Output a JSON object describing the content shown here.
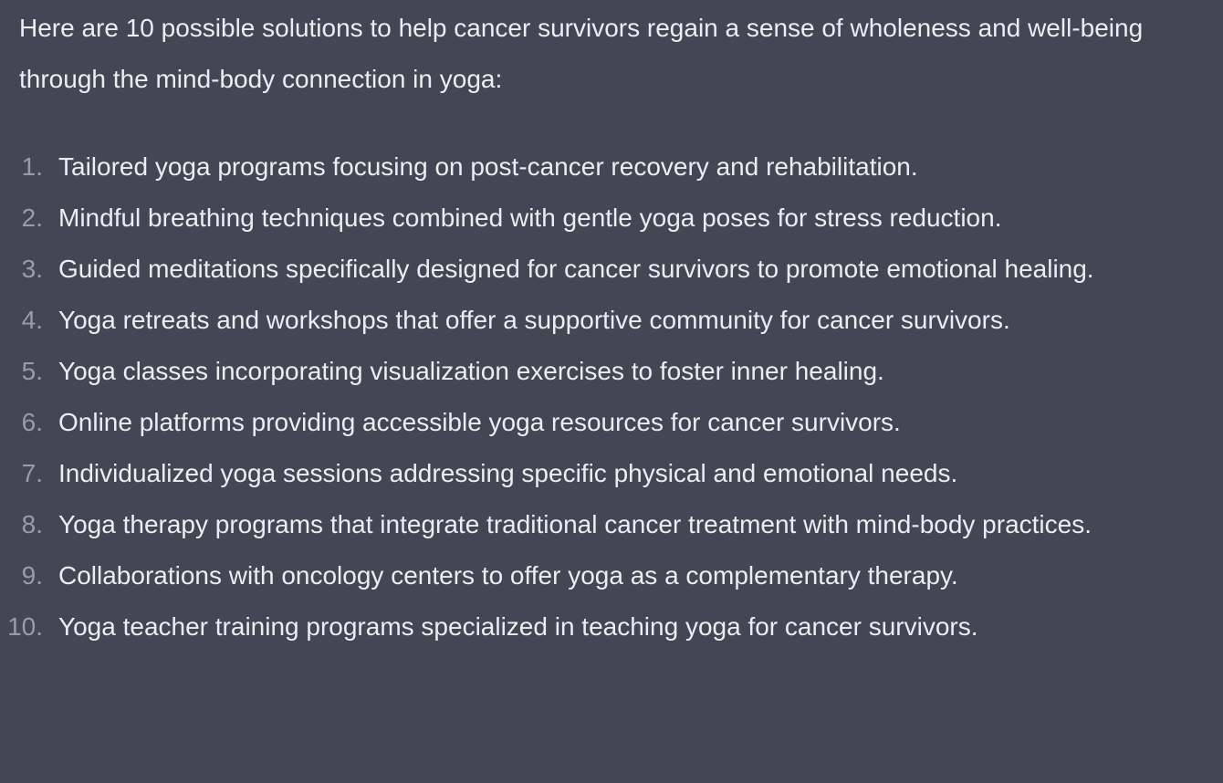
{
  "intro": "Here are 10 possible solutions to help cancer survivors regain a sense of wholeness and well-being through the mind-body connection in yoga:",
  "items": [
    {
      "num": "1.",
      "text": "Tailored yoga programs focusing on post-cancer recovery and rehabilitation."
    },
    {
      "num": "2.",
      "text": "Mindful breathing techniques combined with gentle yoga poses for stress reduction."
    },
    {
      "num": "3.",
      "text": "Guided meditations specifically designed for cancer survivors to promote emotional healing."
    },
    {
      "num": "4.",
      "text": "Yoga retreats and workshops that offer a supportive community for cancer survivors."
    },
    {
      "num": "5.",
      "text": "Yoga classes incorporating visualization exercises to foster inner healing."
    },
    {
      "num": "6.",
      "text": "Online platforms providing accessible yoga resources for cancer survivors."
    },
    {
      "num": "7.",
      "text": "Individualized yoga sessions addressing specific physical and emotional needs."
    },
    {
      "num": "8.",
      "text": "Yoga therapy programs that integrate traditional cancer treatment with mind-body practices."
    },
    {
      "num": "9.",
      "text": "Collaborations with oncology centers to offer yoga as a complementary therapy."
    },
    {
      "num": "10.",
      "text": "Yoga teacher training programs specialized in teaching yoga for cancer survivors."
    }
  ]
}
